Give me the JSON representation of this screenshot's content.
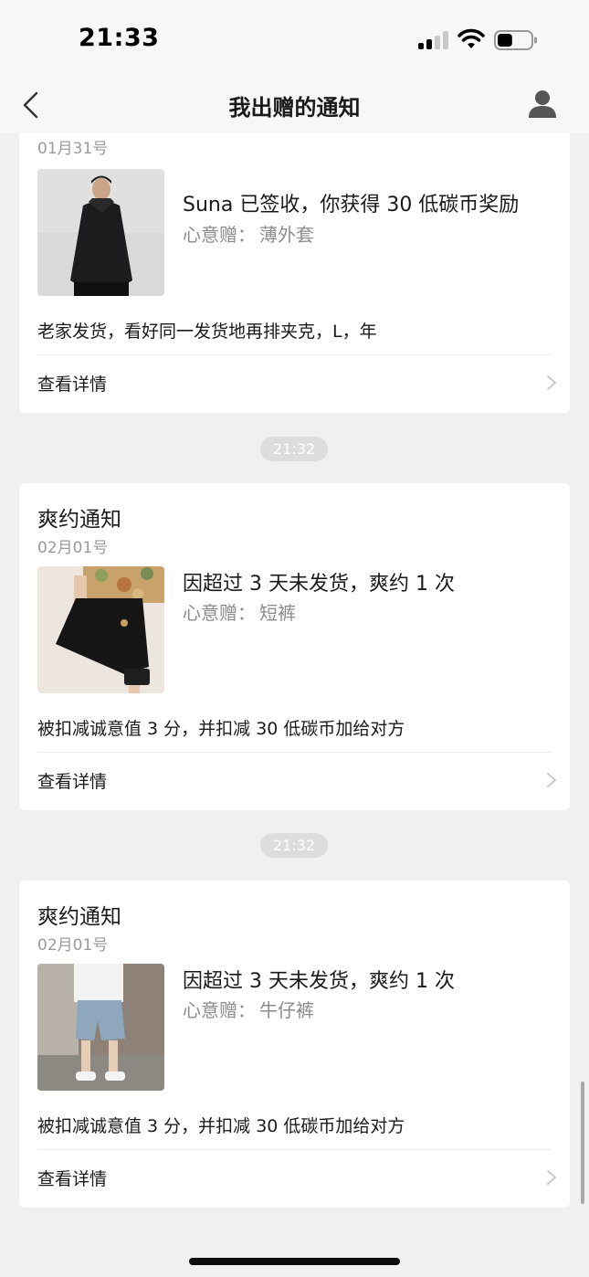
{
  "status_bar": {
    "time": "21:33",
    "signal_icon": "cellular-signal-icon",
    "wifi_icon": "wifi-icon",
    "battery_icon": "battery-icon",
    "battery_level": 0.45
  },
  "nav": {
    "title": "我出赠的通知",
    "back_icon": "chevron-left-icon",
    "profile_icon": "user-icon"
  },
  "notifications": [
    {
      "title": "",
      "date": "01月31号",
      "headline": "Suna 已签收，你获得 30 低碳币奖励",
      "gift_label": "心意赠：",
      "gift_item": "薄外套",
      "description": "老家发货，看好同一发货地再排夹克，L，年",
      "detail_label": "查看详情",
      "image": "black-jacket-photo"
    },
    {
      "time": "21:32",
      "title": "爽约通知",
      "date": "02月01号",
      "headline": "因超过 3 天未发货，爽约 1 次",
      "gift_label": "心意赠：",
      "gift_item": "短裤",
      "description": "被扣减诚意值 3 分，并扣减 30 低碳币加给对方",
      "detail_label": "查看详情",
      "image": "black-skirt-shorts-photo"
    },
    {
      "time": "21:32",
      "title": "爽约通知",
      "date": "02月01号",
      "headline": "因超过 3 天未发货，爽约 1 次",
      "gift_label": "心意赠：",
      "gift_item": "牛仔裤",
      "description": "被扣减诚意值 3 分，并扣减 30 低碳币加给对方",
      "detail_label": "查看详情",
      "image": "denim-shorts-photo"
    }
  ],
  "colors": {
    "background": "#f0f0f0",
    "card": "#ffffff",
    "secondary_text": "#8c8c8c",
    "time_pill": "#dddddd"
  }
}
